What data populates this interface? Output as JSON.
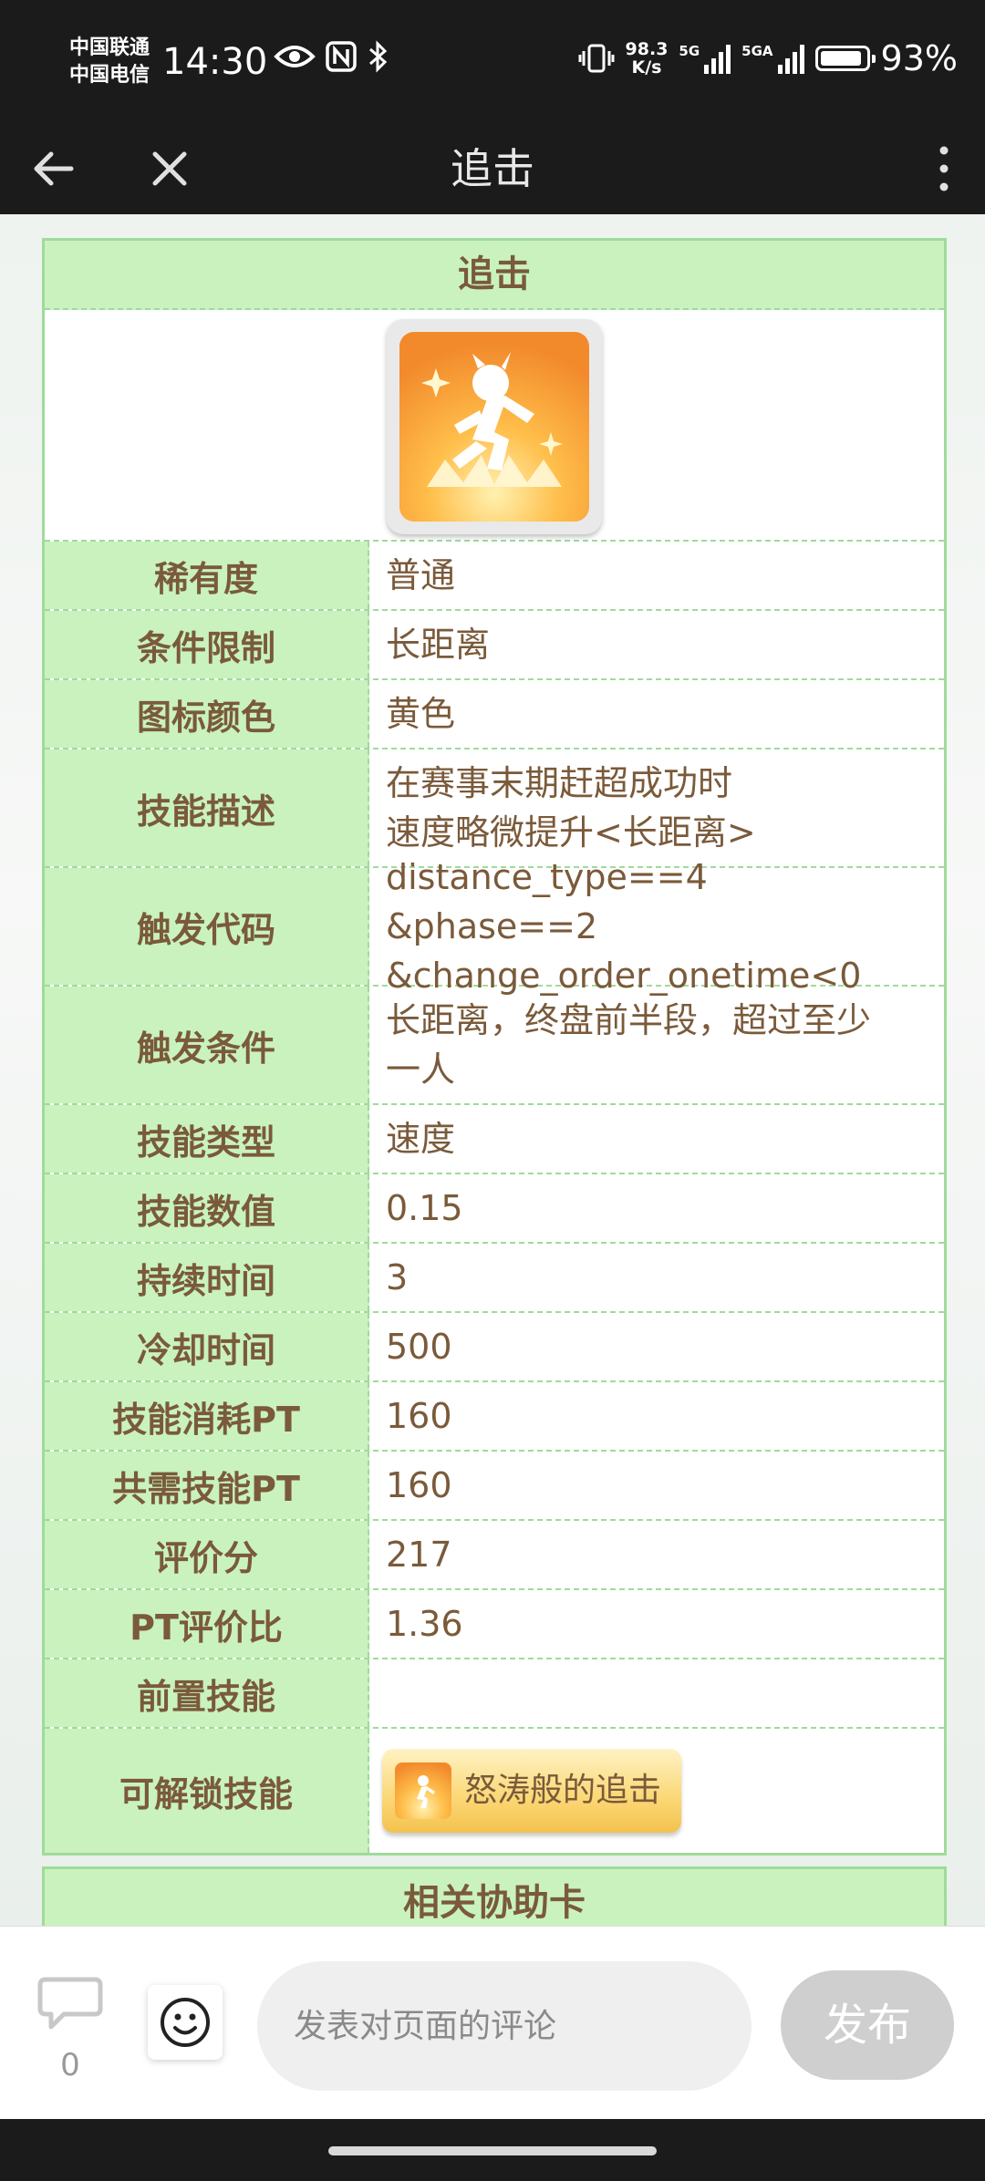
{
  "status_bar": {
    "carrier1": "中国联通",
    "carrier2": "中国电信",
    "time": "14:30",
    "net_speed_value": "98.3",
    "net_speed_unit": "K/s",
    "sig1_label": "5G",
    "sig2_label": "5GA",
    "battery_pct": "93%",
    "battery_level": 0.93
  },
  "app_bar": {
    "title": "追击"
  },
  "skill_card": {
    "header": "追击",
    "rows": [
      {
        "key": "稀有度",
        "value": "普通"
      },
      {
        "key": "条件限制",
        "value": "长距离"
      },
      {
        "key": "图标颜色",
        "value": "黄色"
      },
      {
        "key": "技能描述",
        "value": "在赛事末期赶超成功时\n速度略微提升<长距离>"
      },
      {
        "key": "触发代码",
        "value": "distance_type==4 &phase==2\n&change_order_onetime<0"
      },
      {
        "key": "触发条件",
        "value": "长距离，终盘前半段，超过至少\n一人"
      },
      {
        "key": "技能类型",
        "value": "速度"
      },
      {
        "key": "技能数值",
        "value": "0.15"
      },
      {
        "key": "持续时间",
        "value": "3"
      },
      {
        "key": "冷却时间",
        "value": "500"
      },
      {
        "key": "技能消耗PT",
        "value": "160"
      },
      {
        "key": "共需技能PT",
        "value": "160"
      },
      {
        "key": "评价分",
        "value": "217"
      },
      {
        "key": "PT评价比",
        "value": "1.36"
      },
      {
        "key": "前置技能",
        "value": ""
      },
      {
        "key": "可解锁技能",
        "value": ""
      }
    ],
    "unlock_skill_label": "怒涛般的追击"
  },
  "support_card": {
    "header": "相关协助卡"
  },
  "bottom_bar": {
    "comment_count": "0",
    "comment_placeholder": "发表对页面的评论",
    "publish_label": "发布"
  }
}
